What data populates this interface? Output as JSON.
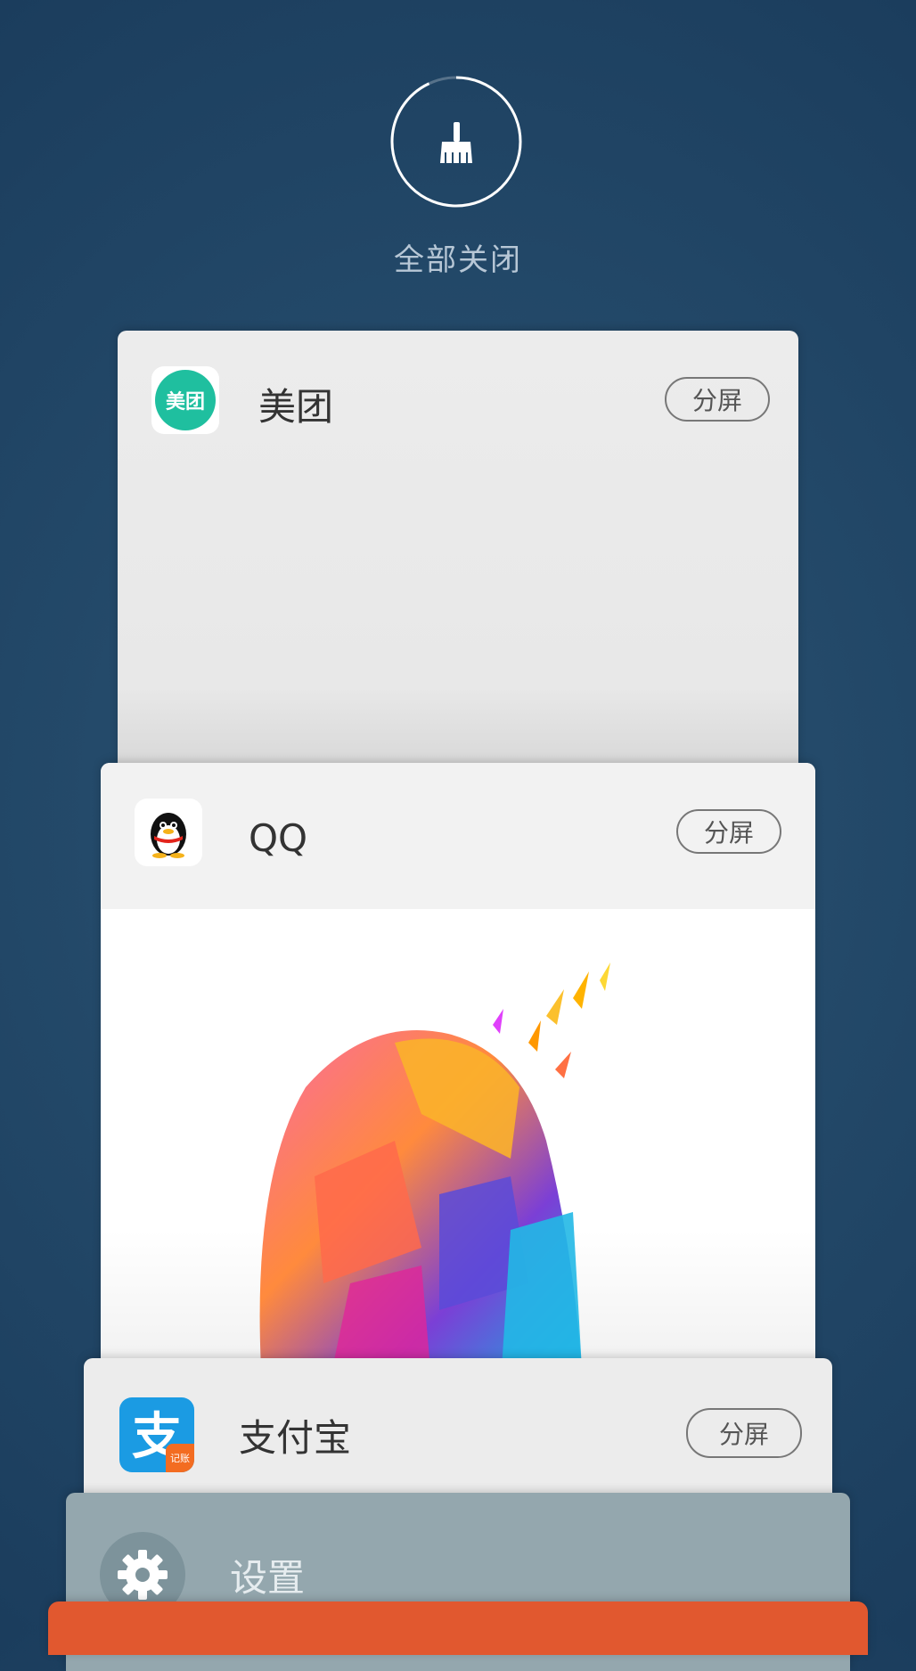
{
  "clear_all": {
    "label": "全部关闭",
    "icon": "broom-icon",
    "progress": 0.93
  },
  "cards": {
    "meituan": {
      "name": "美团",
      "icon_text": "美团",
      "split_label": "分屏",
      "icon_color": "#1fbf9f"
    },
    "qq": {
      "name": "QQ",
      "split_label": "分屏"
    },
    "alipay": {
      "name": "支付宝",
      "icon_text": "支",
      "icon_badge": "记账",
      "split_label": "分屏",
      "icon_color": "#1b9be3"
    },
    "settings": {
      "name": "设置",
      "icon": "gear-icon"
    }
  },
  "colors": {
    "accent_orange": "#e1582f",
    "background": "#244a6a"
  }
}
